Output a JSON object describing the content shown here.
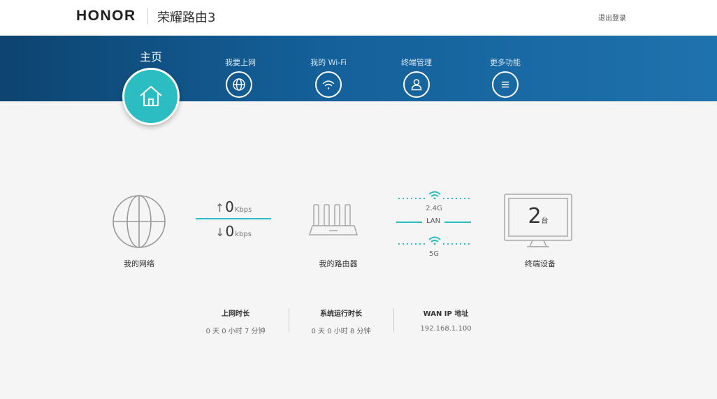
{
  "header": {
    "brand": "HONOR",
    "product": "荣耀路由3",
    "logout": "退出登录"
  },
  "nav": {
    "home": "主页",
    "items": [
      {
        "label": "我要上网",
        "icon": "globe-icon"
      },
      {
        "label": "我的 Wi-Fi",
        "icon": "wifi-icon"
      },
      {
        "label": "终端管理",
        "icon": "user-icon"
      },
      {
        "label": "更多功能",
        "icon": "menu-icon"
      }
    ]
  },
  "diagram": {
    "network_label": "我的网络",
    "upload": {
      "value": "0",
      "unit": "Kbps"
    },
    "download": {
      "value": "0",
      "unit": "kbps"
    },
    "router_label": "我的路由器",
    "band_24": "2.4G",
    "lan": "LAN",
    "band_5": "5G",
    "devices_count": "2",
    "devices_unit": "台",
    "devices_label": "终端设备"
  },
  "stats": [
    {
      "title": "上网时长",
      "value": "0 天 0 小时 7 分钟"
    },
    {
      "title": "系统运行时长",
      "value": "0 天 0 小时 8 分钟"
    },
    {
      "title": "WAN IP 地址",
      "value": "192.168.1.100"
    }
  ],
  "colors": {
    "accent": "#2bbdc2",
    "nav_dark": "#0d4470",
    "nav_light": "#1e72ad"
  }
}
